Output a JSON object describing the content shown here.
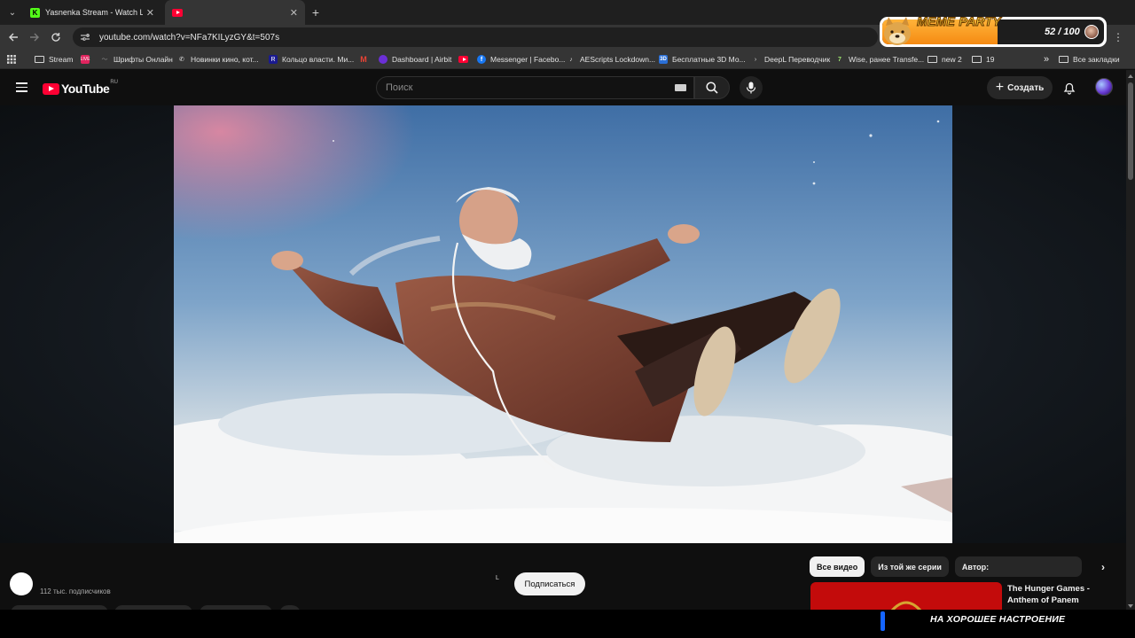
{
  "tabs": [
    {
      "title": "Yasnenka Stream - Watch Live o",
      "favicon": "kick-icon"
    },
    {
      "title": "",
      "favicon": "youtube-icon"
    }
  ],
  "address_bar": {
    "url": "youtube.com/watch?v=NFa7KILyzGY&t=507s"
  },
  "bookmarks": {
    "items": [
      {
        "label": "Stream",
        "icon": "folder-icon"
      },
      {
        "label": "",
        "icon": "live-icon"
      },
      {
        "label": "Шрифты Онлайн",
        "icon": "font-icon"
      },
      {
        "label": "Новинки кино, кот...",
        "icon": "film-icon"
      },
      {
        "label": "Кольцо власти. Ми...",
        "icon": "r-icon"
      },
      {
        "label": "",
        "icon": "gmail-icon"
      },
      {
        "label": "Dashboard | Airbit",
        "icon": "airbit-icon"
      },
      {
        "label": "",
        "icon": "youtube-icon"
      },
      {
        "label": "Messenger | Facebo...",
        "icon": "facebook-icon"
      },
      {
        "label": "AEScripts Lockdown...",
        "icon": "tiktok-icon"
      },
      {
        "label": "Бесплатные 3D Мо...",
        "icon": "3d-icon"
      },
      {
        "label": "DeepL Переводчик",
        "icon": "deepl-icon"
      },
      {
        "label": "Wise, ранее Transfe...",
        "icon": "wise-icon"
      },
      {
        "label": "new 2",
        "icon": "folder-icon"
      },
      {
        "label": "19",
        "icon": "folder-icon"
      }
    ],
    "more": "»",
    "all_bookmarks": "Все закладки"
  },
  "youtube": {
    "logo_text": "YouTube",
    "region": "RU",
    "search_placeholder": "Поиск",
    "create_label": "Создать",
    "subscriber_count": "112 тыс. подписчиков",
    "stray_letter": "L",
    "subscribe_label": "Подписаться",
    "chips": [
      "Все видео",
      "Из той же серии",
      "Автор:"
    ],
    "recommendation_title": "The Hunger Games - Anthem of Panem"
  },
  "overlay": {
    "meme_title": "MEME PARTY",
    "meme_count": "52 / 100",
    "meme_progress": 0.52,
    "caption": "НА ХОРОШЕЕ НАСТРОЕНИЕ"
  },
  "colors": {
    "youtube_red": "#ff0033",
    "meme_orange": "#f58a12",
    "kick_green": "#53fc18"
  }
}
